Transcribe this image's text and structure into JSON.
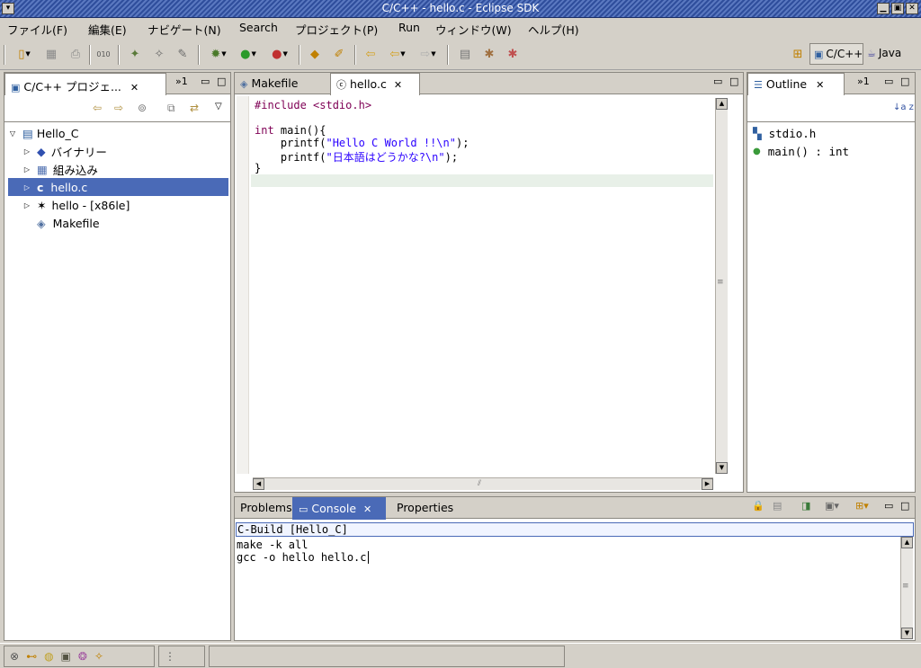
{
  "window": {
    "title": "C/C++ - hello.c - Eclipse SDK",
    "menu_icon": "▾",
    "min_icon": "▁",
    "max_icon": "▣",
    "close_icon": "✕"
  },
  "menu": [
    "ファイル(F)",
    "編集(E)",
    "ナビゲート(N)",
    "Search",
    "プロジェクト(P)",
    "Run",
    "ウィンドウ(W)",
    "ヘルプ(H)"
  ],
  "perspectives": {
    "cpp": "C/C++",
    "java": "Java"
  },
  "project_explorer": {
    "tab_label": "C/C++ プロジェ...",
    "overflow": "»1",
    "tree": [
      {
        "label": "Hello_C",
        "icon": "project-icon",
        "expanded": true
      },
      {
        "label": "バイナリー",
        "icon": "binary-icon"
      },
      {
        "label": "組み込み",
        "icon": "includes-icon"
      },
      {
        "label": "hello.c",
        "icon": "c-file-icon",
        "selected": true
      },
      {
        "label": "hello - [x86le]",
        "icon": "executable-icon"
      },
      {
        "label": "Makefile",
        "icon": "makefile-icon"
      }
    ]
  },
  "editor": {
    "tabs": [
      {
        "label": "Makefile"
      },
      {
        "label": "hello.c",
        "active": true
      }
    ],
    "code": {
      "line1": "#include <stdio.h>",
      "line3_kw": "int",
      "line3_rest": " main(){",
      "line4_pre": "    printf(",
      "line4_str": "\"Hello C World !!\\n\"",
      "line4_post": ");",
      "line5_pre": "    printf(",
      "line5_str": "\"日本語はどうかな?\\n\"",
      "line5_post": ");",
      "line6": "}"
    }
  },
  "outline": {
    "tab_label": "Outline",
    "overflow": "»1",
    "sort_icon": "↓a z",
    "items": [
      {
        "label": "stdio.h",
        "icon": "include-icon"
      },
      {
        "label": "main() : int",
        "icon": "function-icon"
      }
    ]
  },
  "bottom": {
    "tabs": [
      {
        "label": "Problems"
      },
      {
        "label": "Console",
        "active": true
      },
      {
        "label": "Properties"
      }
    ],
    "console": {
      "header": "C-Build [Hello_C]",
      "lines": [
        "make -k all",
        "gcc -o hello hello.c"
      ]
    }
  },
  "colors": {
    "selection": "#4a6ab7",
    "keyword": "#7f0055",
    "string": "#2a00ff",
    "console_header": "#f0f4ff"
  }
}
